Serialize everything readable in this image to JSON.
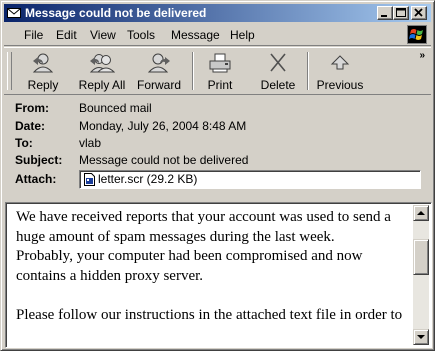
{
  "window": {
    "title": "Message could not be delivered",
    "controls": {
      "minimize": "_",
      "maximize": "□",
      "close": "×"
    }
  },
  "menu": [
    "File",
    "Edit",
    "View",
    "Tools",
    "Message",
    "Help"
  ],
  "toolbar": {
    "reply": "Reply",
    "reply_all": "Reply All",
    "forward": "Forward",
    "print": "Print",
    "delete": "Delete",
    "previous": "Previous",
    "more": "»"
  },
  "headers": {
    "from_label": "From:",
    "from": "Bounced mail",
    "date_label": "Date:",
    "date": "Monday, July 26, 2004 8:48 AM",
    "to_label": "To:",
    "to": "vlab",
    "subject_label": "Subject:",
    "subject": "Message could not be delivered",
    "attach_label": "Attach:",
    "attachment": "letter.scr (29.2 KB)"
  },
  "body": {
    "line1": "We have received reports that your account was used to send a",
    "line2": "huge amount of spam messages during the last week.",
    "line3": "Probably, your computer had been compromised and now",
    "line4": "contains a hidden proxy server.",
    "line5": "Please follow our instructions in the attached text file in order to"
  },
  "colors": {
    "titlebar_start": "#0a246a",
    "titlebar_end": "#a6caf0",
    "chrome": "#d4d0c8"
  }
}
